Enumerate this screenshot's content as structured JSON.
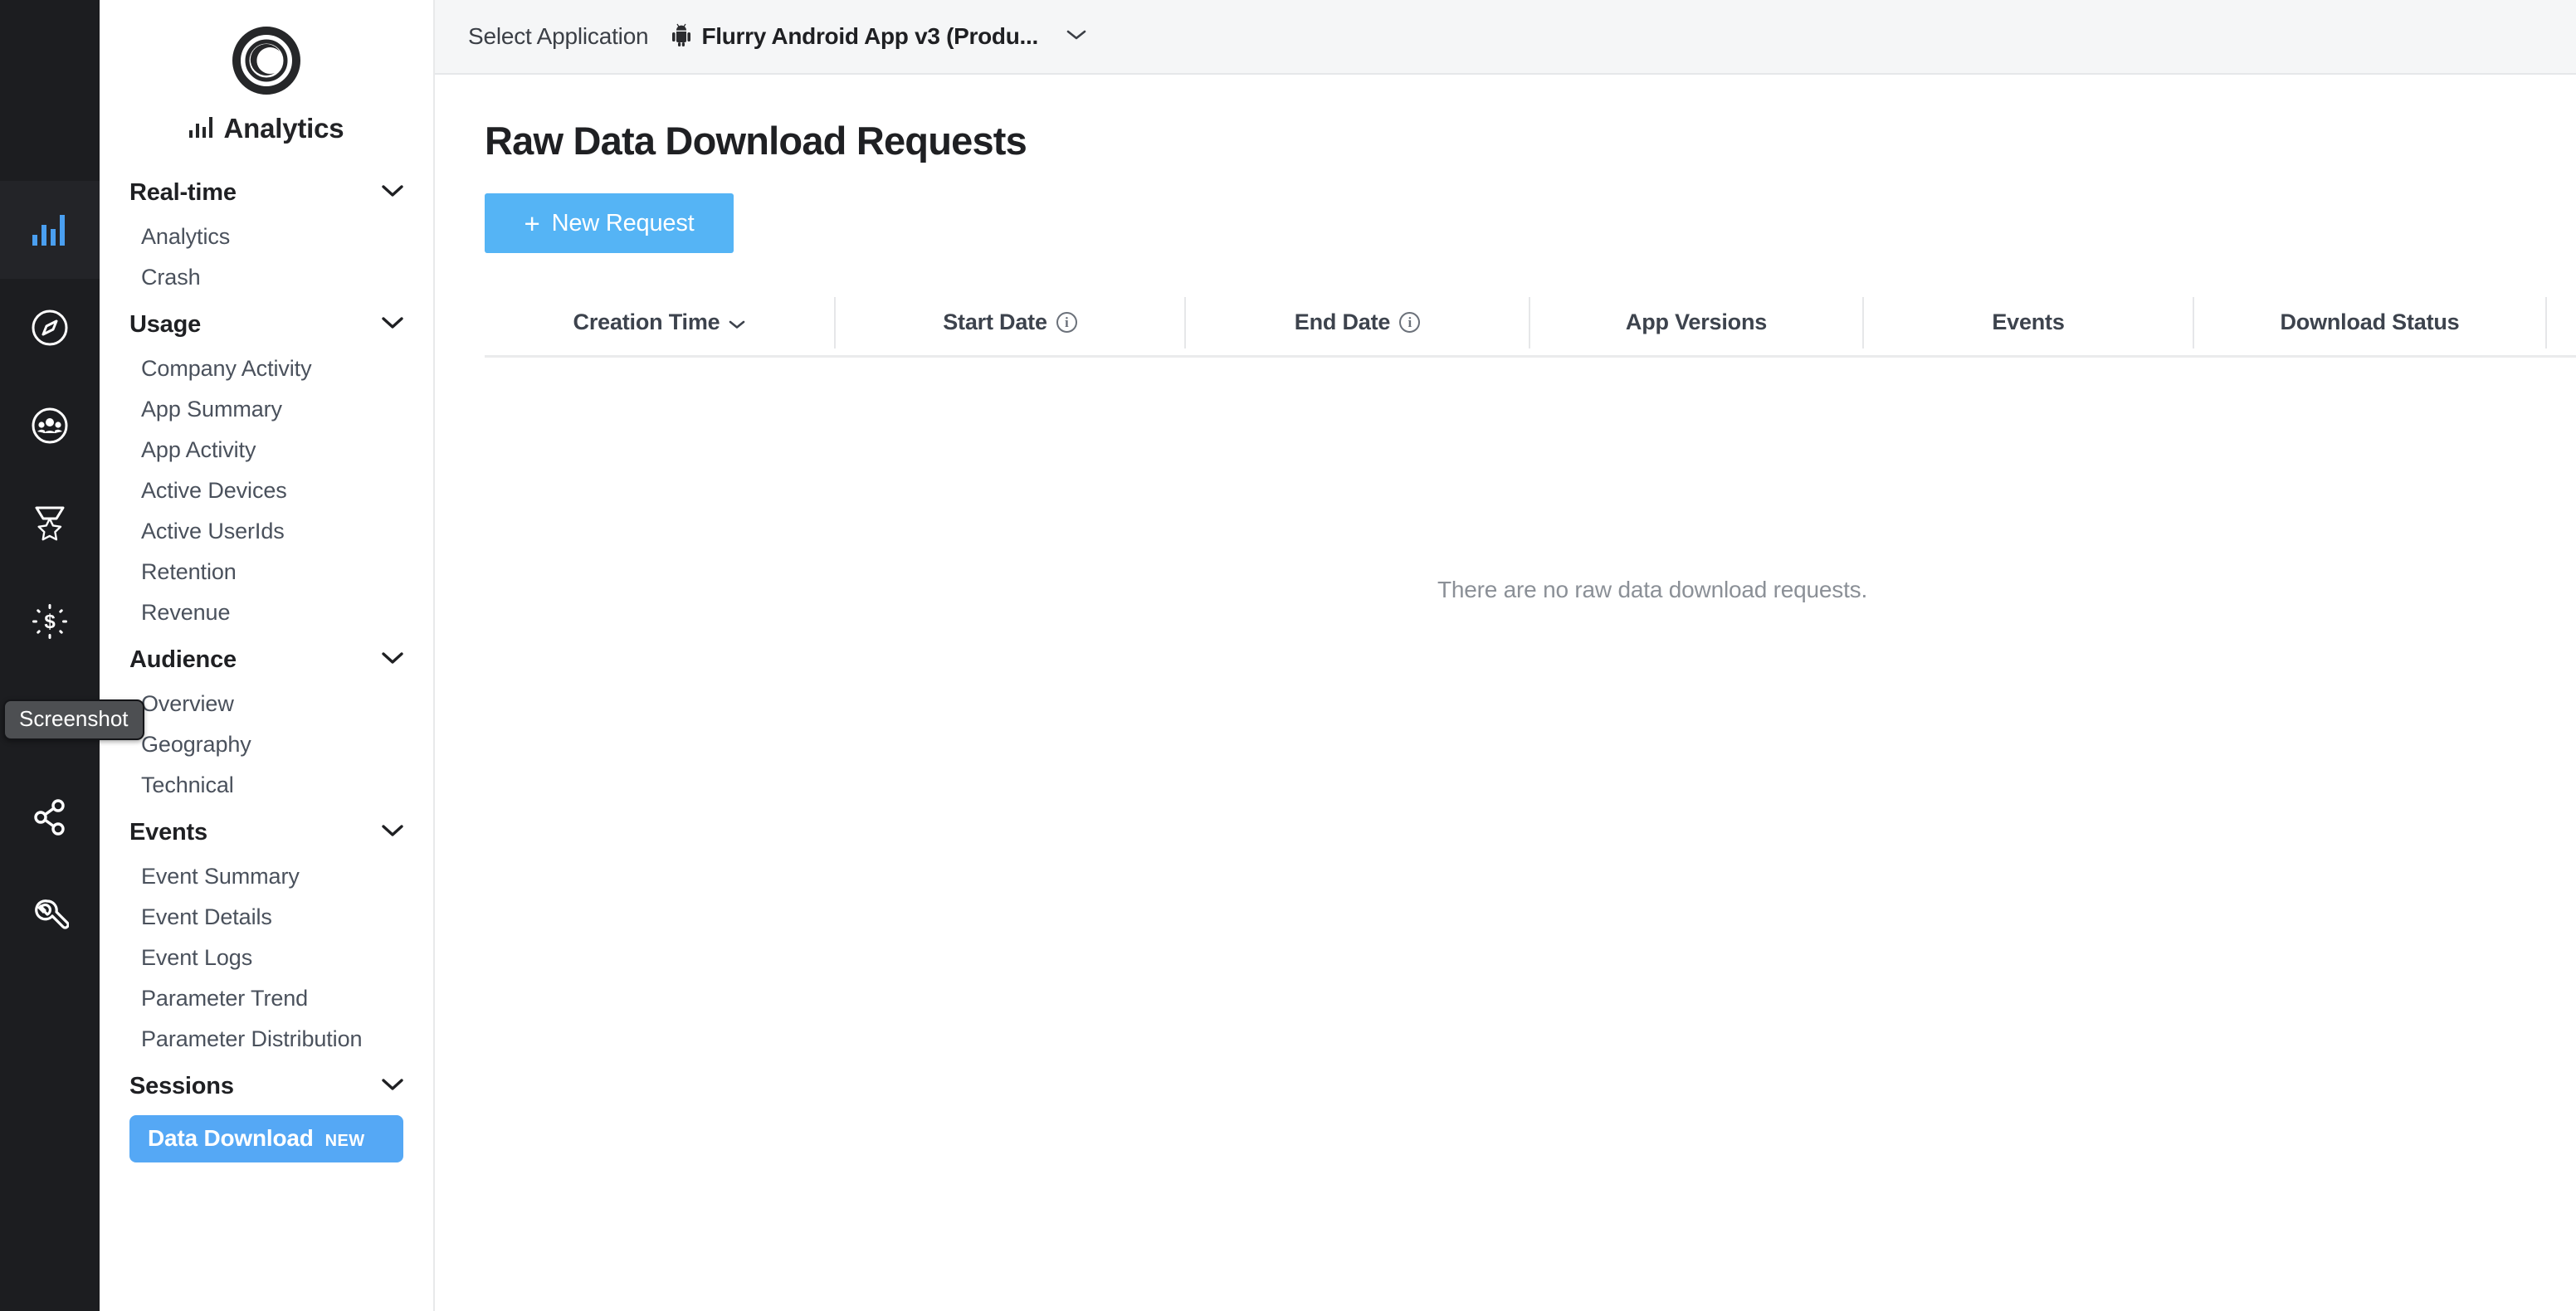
{
  "rail": {
    "items": [
      {
        "name": "analytics-bars-icon",
        "label": "Analytics",
        "active": true
      },
      {
        "name": "compass-icon",
        "label": "Explorer",
        "active": false
      },
      {
        "name": "audience-people-icon",
        "label": "Audience",
        "active": false
      },
      {
        "name": "medal-star-icon",
        "label": "Achievements",
        "active": false
      },
      {
        "name": "monetization-dollar-icon",
        "label": "Monetization",
        "active": false
      },
      {
        "name": "smiley-face-icon",
        "label": "Screenshot",
        "active": false
      },
      {
        "name": "share-network-icon",
        "label": "Attribution",
        "active": false
      },
      {
        "name": "wrench-tools-icon",
        "label": "Tools",
        "active": false
      }
    ],
    "tooltip": "Screenshot"
  },
  "sidebar": {
    "brand": {
      "logo": "flurry-logo-icon",
      "title": "Analytics",
      "title_icon": "bar-chart-icon"
    },
    "groups": [
      {
        "title": "Real-time",
        "items": [
          "Analytics",
          "Crash"
        ]
      },
      {
        "title": "Usage",
        "items": [
          "Company Activity",
          "App Summary",
          "App Activity",
          "Active Devices",
          "Active UserIds",
          "Retention",
          "Revenue"
        ]
      },
      {
        "title": "Audience",
        "items": [
          "Overview",
          "Geography",
          "Technical"
        ]
      },
      {
        "title": "Events",
        "items": [
          "Event Summary",
          "Event Details",
          "Event Logs",
          "Parameter Trend",
          "Parameter Distribution"
        ]
      },
      {
        "title": "Sessions",
        "items": []
      }
    ],
    "active_item": {
      "label": "Data Download",
      "badge": "NEW"
    }
  },
  "topbar": {
    "label": "Select Application",
    "app_icon": "android-robot-icon",
    "app_name": "Flurry Android App v3 (Produ...",
    "chevron": "chevron-down-icon"
  },
  "page": {
    "title": "Raw Data Download Requests",
    "new_request_button": {
      "plus": "+",
      "label": "New Request"
    },
    "table": {
      "columns": [
        {
          "label": "Creation Time",
          "sortable": true,
          "info": false
        },
        {
          "label": "Start Date",
          "sortable": false,
          "info": true
        },
        {
          "label": "End Date",
          "sortable": false,
          "info": true
        },
        {
          "label": "App Versions",
          "sortable": false,
          "info": false
        },
        {
          "label": "Events",
          "sortable": false,
          "info": false
        },
        {
          "label": "Download Status",
          "sortable": false,
          "info": false
        }
      ],
      "rows": [],
      "empty_message": "There are no raw data download requests."
    }
  },
  "colors": {
    "accent_blue": "#55b4f5",
    "sidebar_active_blue": "#55a8f5",
    "rail_bg": "#1c1d20",
    "rail_active_bg": "#232428",
    "topbar_bg": "#f5f6f7",
    "text_dark": "#1f2023",
    "text_muted": "#4a515c",
    "empty_text": "#8b9097"
  }
}
